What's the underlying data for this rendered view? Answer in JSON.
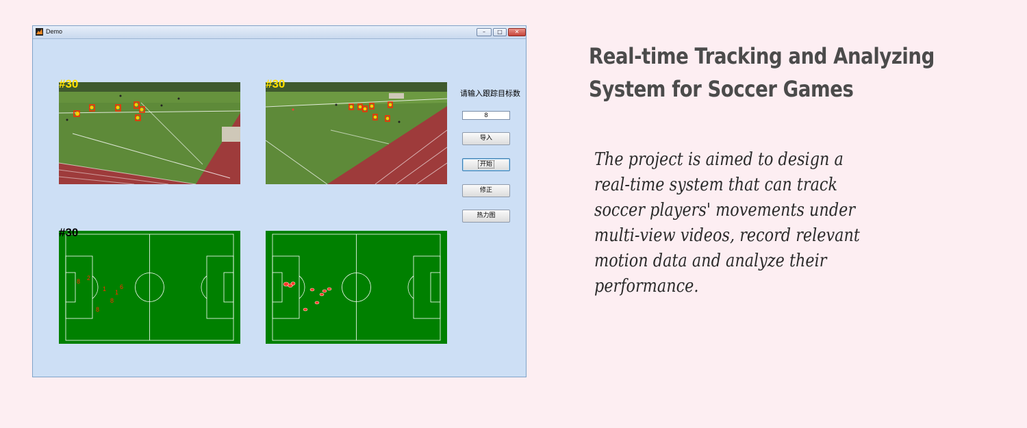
{
  "window": {
    "title": "Demo",
    "controls": {
      "minimize": "–",
      "maximize": "□",
      "close": "✕"
    }
  },
  "views": {
    "camera1_frame_label": "#30",
    "camera2_frame_label": "#30",
    "pitch1_frame_label": "#30"
  },
  "form": {
    "prompt_label": "请输入跟踪目标数",
    "target_count_value": "8",
    "buttons": {
      "import_label": "导入",
      "start_label": "开始",
      "correct_label": "修正",
      "heatmap_label": "热力图"
    }
  },
  "pitch1_player_labels": [
    "8",
    "2",
    "1",
    "6",
    "1",
    "8",
    "8"
  ],
  "colors": {
    "window_bg": "#cddff5",
    "pitch_green": "#008000",
    "track_red": "#9e3b3b",
    "grass": "#5e8a39",
    "frame_label_yellow": "#ffe000",
    "page_bg": "#fdeef2"
  },
  "headline": {
    "line1": "Real-time Tracking and Analyzing",
    "line2": "System for Soccer Games"
  },
  "description": "The project is aimed to design a real-time system that can track soccer players' movements under multi-view videos, record relevant motion data and analyze their performance."
}
